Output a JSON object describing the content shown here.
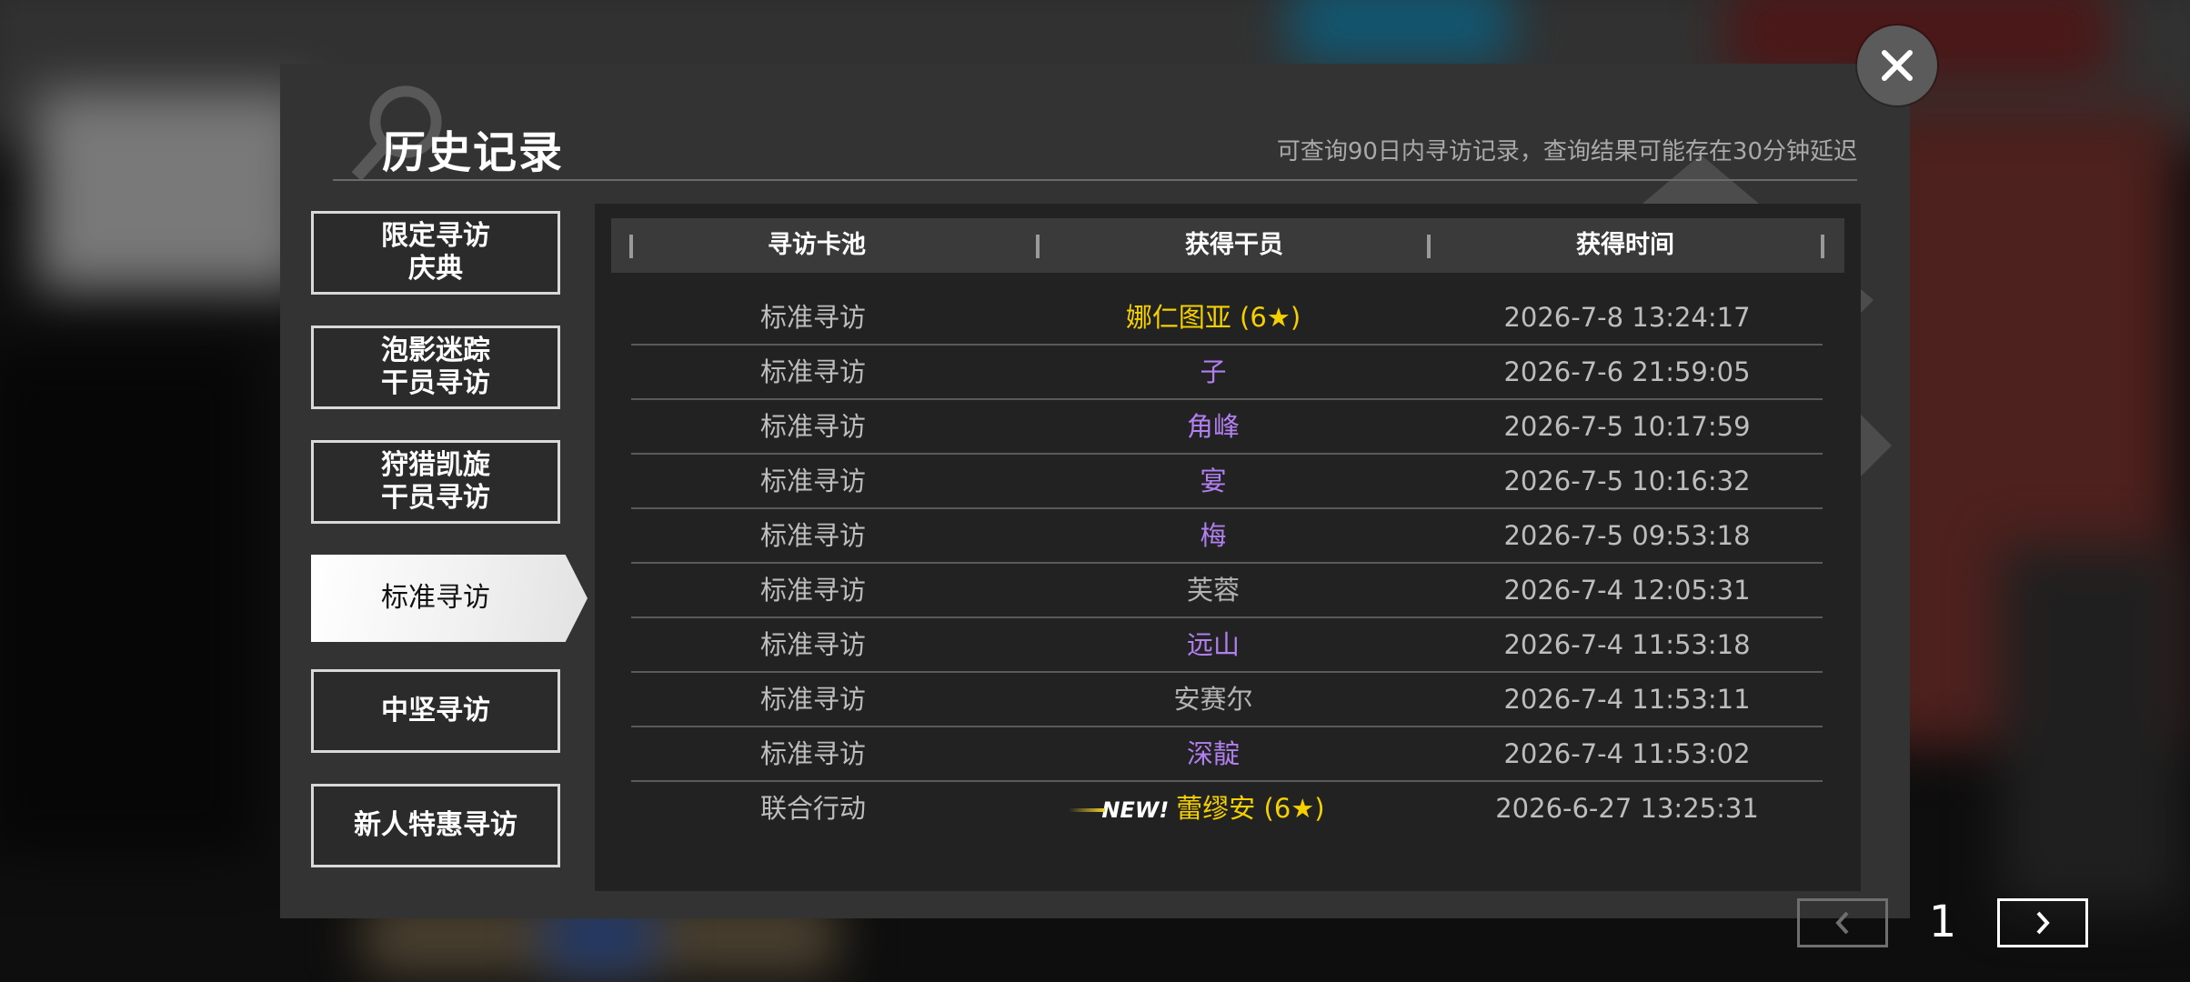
{
  "dialog": {
    "title": "历史记录",
    "subtitle": "可查询90日内寻访记录，查询结果可能存在30分钟延迟"
  },
  "tabs": [
    {
      "label": "限定寻访\n庆典",
      "active": false
    },
    {
      "label": "泡影迷踪\n干员寻访",
      "active": false
    },
    {
      "label": "狩猎凯旋\n干员寻访",
      "active": false
    },
    {
      "label": "标准寻访",
      "active": true
    },
    {
      "label": "中坚寻访",
      "active": false
    },
    {
      "label": "新人特惠寻访",
      "active": false
    }
  ],
  "table": {
    "headers": [
      "寻访卡池",
      "获得干员",
      "获得时间"
    ],
    "rows": [
      {
        "pool": "标准寻访",
        "operator": "娜仁图亚 (6★)",
        "time": "2026-7-8 13:24:17",
        "rarity": "six"
      },
      {
        "pool": "标准寻访",
        "operator": "子",
        "time": "2026-7-6 21:59:05",
        "rarity": "four"
      },
      {
        "pool": "标准寻访",
        "operator": "角峰",
        "time": "2026-7-5 10:17:59",
        "rarity": "four"
      },
      {
        "pool": "标准寻访",
        "operator": "宴",
        "time": "2026-7-5 10:16:32",
        "rarity": "four"
      },
      {
        "pool": "标准寻访",
        "operator": "梅",
        "time": "2026-7-5 09:53:18",
        "rarity": "four"
      },
      {
        "pool": "标准寻访",
        "operator": "芙蓉",
        "time": "2026-7-4 12:05:31",
        "rarity": "three"
      },
      {
        "pool": "标准寻访",
        "operator": "远山",
        "time": "2026-7-4 11:53:18",
        "rarity": "four"
      },
      {
        "pool": "标准寻访",
        "operator": "安赛尔",
        "time": "2026-7-4 11:53:11",
        "rarity": "three"
      },
      {
        "pool": "标准寻访",
        "operator": "深靛",
        "time": "2026-7-4 11:53:02",
        "rarity": "four"
      },
      {
        "pool": "联合行动",
        "operator": "蕾缪安 (6★)",
        "time": "2026-6-27 13:25:31",
        "rarity": "six",
        "badge": "NEW!"
      }
    ]
  },
  "pager": {
    "page": "1"
  },
  "colors": {
    "six_star": "#f5d000",
    "four_star": "#b27ff0",
    "three_star": "#b3b3b3",
    "text_default": "#bdbdbd"
  },
  "icons": {
    "close": "close-icon",
    "prev": "chevron-left-icon",
    "next": "chevron-right-icon"
  }
}
